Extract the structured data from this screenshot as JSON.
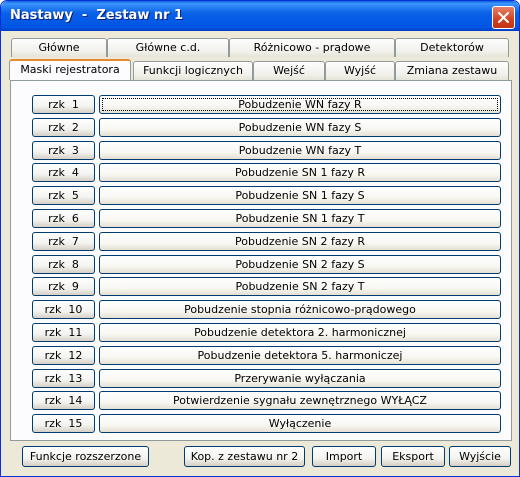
{
  "window": {
    "title": "Nastawy  -  Zestaw nr 1"
  },
  "tabs_row1": [
    {
      "label": "Główne"
    },
    {
      "label": "Główne c.d."
    },
    {
      "label": "Różnicowo - prądowe"
    },
    {
      "label": "Detektorów"
    }
  ],
  "tabs_row2": [
    {
      "label": "Maski rejestratora"
    },
    {
      "label": "Funkcji logicznych"
    },
    {
      "label": "Wejść"
    },
    {
      "label": "Wyjść"
    },
    {
      "label": "Zmiana zestawu"
    }
  ],
  "rows": [
    {
      "button": "rzk  1",
      "signal": "Pobudzenie WN fazy R"
    },
    {
      "button": "rzk  2",
      "signal": "Pobudzenie WN fazy S"
    },
    {
      "button": "rzk  3",
      "signal": "Pobudzenie WN fazy T"
    },
    {
      "button": "rzk  4",
      "signal": "Pobudzenie SN 1 fazy R"
    },
    {
      "button": "rzk  5",
      "signal": "Pobudzenie SN 1 fazy S"
    },
    {
      "button": "rzk  6",
      "signal": "Pobudzenie SN 1 fazy T"
    },
    {
      "button": "rzk  7",
      "signal": "Pobudzenie SN 2 fazy R"
    },
    {
      "button": "rzk  8",
      "signal": "Pobudzenie SN 2 fazy S"
    },
    {
      "button": "rzk  9",
      "signal": "Pobudzenie SN 2 fazy T"
    },
    {
      "button": "rzk  10",
      "signal": "Pobudzenie stopnia różnicowo-prądowego"
    },
    {
      "button": "rzk  11",
      "signal": "Pobudzenie detektora 2. harmonicznej"
    },
    {
      "button": "rzk  12",
      "signal": "Pobudzenie detektora 5. harmoniczej"
    },
    {
      "button": "rzk  13",
      "signal": "Przerywanie wyłączania"
    },
    {
      "button": "rzk  14",
      "signal": "Potwierdzenie sygnału zewnętrznego WYŁĄCZ"
    },
    {
      "button": "rzk  15",
      "signal": "Wyłączenie"
    }
  ],
  "buttons": {
    "extended": "Funkcje rozszerzone",
    "copy": "Kop. z zestawu nr 2",
    "import": "Import",
    "export": "Eksport",
    "exit": "Wyjście"
  },
  "icons": {
    "close": "close-icon"
  },
  "colors": {
    "titlebar": "#0055e5",
    "active_tab_accent": "#e68b2c",
    "window_bg": "#ece9d8"
  }
}
